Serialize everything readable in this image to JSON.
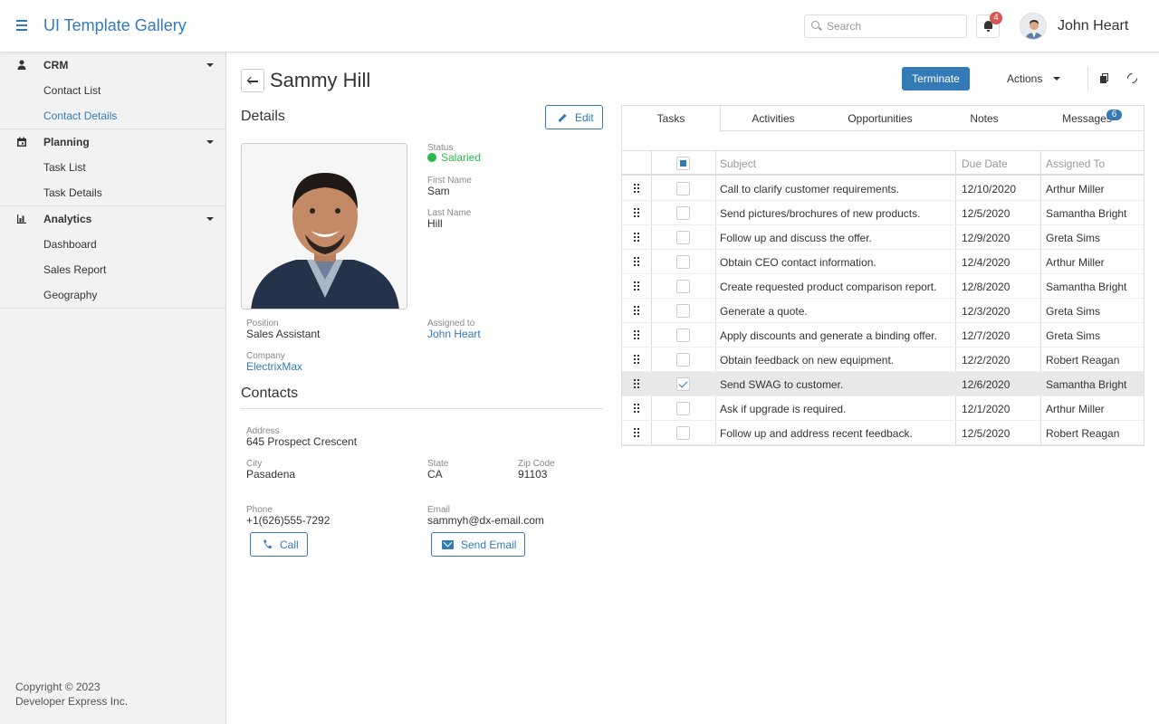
{
  "app": {
    "title": "UI Template Gallery"
  },
  "header": {
    "search_placeholder": "Search",
    "notifications_count": "4",
    "user_name": "John Heart"
  },
  "sidebar": {
    "groups": [
      {
        "label": "CRM",
        "icon": "person-icon",
        "items": [
          {
            "label": "Contact List",
            "active": false
          },
          {
            "label": "Contact Details",
            "active": true
          }
        ]
      },
      {
        "label": "Planning",
        "icon": "calendar-icon",
        "items": [
          {
            "label": "Task List",
            "active": false
          },
          {
            "label": "Task Details",
            "active": false
          }
        ]
      },
      {
        "label": "Analytics",
        "icon": "bar-chart-icon",
        "items": [
          {
            "label": "Dashboard",
            "active": false
          },
          {
            "label": "Sales Report",
            "active": false
          },
          {
            "label": "Geography",
            "active": false
          }
        ]
      }
    ],
    "copyright_line1": "Copyright © 2023",
    "copyright_line2": "Developer Express Inc."
  },
  "page": {
    "title": "Sammy Hill",
    "terminate_label": "Terminate",
    "actions_label": "Actions"
  },
  "details": {
    "title": "Details",
    "edit_label": "Edit",
    "status_label": "Status",
    "status_value": "Salaried",
    "status_color": "#2db84b",
    "first_name_label": "First Name",
    "first_name": "Sam",
    "last_name_label": "Last Name",
    "last_name": "Hill",
    "position_label": "Position",
    "position": "Sales Assistant",
    "assigned_label": "Assigned to",
    "assigned": "John Heart",
    "company_label": "Company",
    "company": "ElectrixMax"
  },
  "contacts": {
    "title": "Contacts",
    "address_label": "Address",
    "address": "645 Prospect Crescent",
    "city_label": "City",
    "city": "Pasadena",
    "state_label": "State",
    "state": "CA",
    "zip_label": "Zip Code",
    "zip": "91103",
    "phone_label": "Phone",
    "phone": "+1(626)555-7292",
    "email_label": "Email",
    "email": "sammyh@dx-email.com",
    "call_label": "Call",
    "send_email_label": "Send Email"
  },
  "tabs": {
    "items": [
      "Tasks",
      "Activities",
      "Opportunities",
      "Notes",
      "Messages"
    ],
    "messages_badge": "6"
  },
  "tasks_grid": {
    "columns": [
      "Subject",
      "Due Date",
      "Assigned To"
    ],
    "rows": [
      {
        "subject": "Call to clarify customer requirements.",
        "due": "12/10/2020",
        "assigned": "Arthur Miller",
        "checked": false
      },
      {
        "subject": "Send pictures/brochures of new products.",
        "due": "12/5/2020",
        "assigned": "Samantha Bright",
        "checked": false
      },
      {
        "subject": "Follow up and discuss the offer.",
        "due": "12/9/2020",
        "assigned": "Greta Sims",
        "checked": false
      },
      {
        "subject": "Obtain CEO contact information.",
        "due": "12/4/2020",
        "assigned": "Arthur Miller",
        "checked": false
      },
      {
        "subject": "Create requested product comparison report.",
        "due": "12/8/2020",
        "assigned": "Samantha Bright",
        "checked": false
      },
      {
        "subject": "Generate a quote.",
        "due": "12/3/2020",
        "assigned": "Greta Sims",
        "checked": false
      },
      {
        "subject": "Apply discounts and generate a binding offer.",
        "due": "12/7/2020",
        "assigned": "Greta Sims",
        "checked": false
      },
      {
        "subject": "Obtain feedback on new equipment.",
        "due": "12/2/2020",
        "assigned": "Robert Reagan",
        "checked": false
      },
      {
        "subject": "Send SWAG to customer.",
        "due": "12/6/2020",
        "assigned": "Samantha Bright",
        "checked": true
      },
      {
        "subject": "Ask if upgrade is required.",
        "due": "12/1/2020",
        "assigned": "Arthur Miller",
        "checked": false
      },
      {
        "subject": "Follow up and address recent feedback.",
        "due": "12/5/2020",
        "assigned": "Robert Reagan",
        "checked": false
      }
    ]
  },
  "colors": {
    "accent": "#337ab7",
    "danger": "#d9534f",
    "success": "#2db84b"
  }
}
